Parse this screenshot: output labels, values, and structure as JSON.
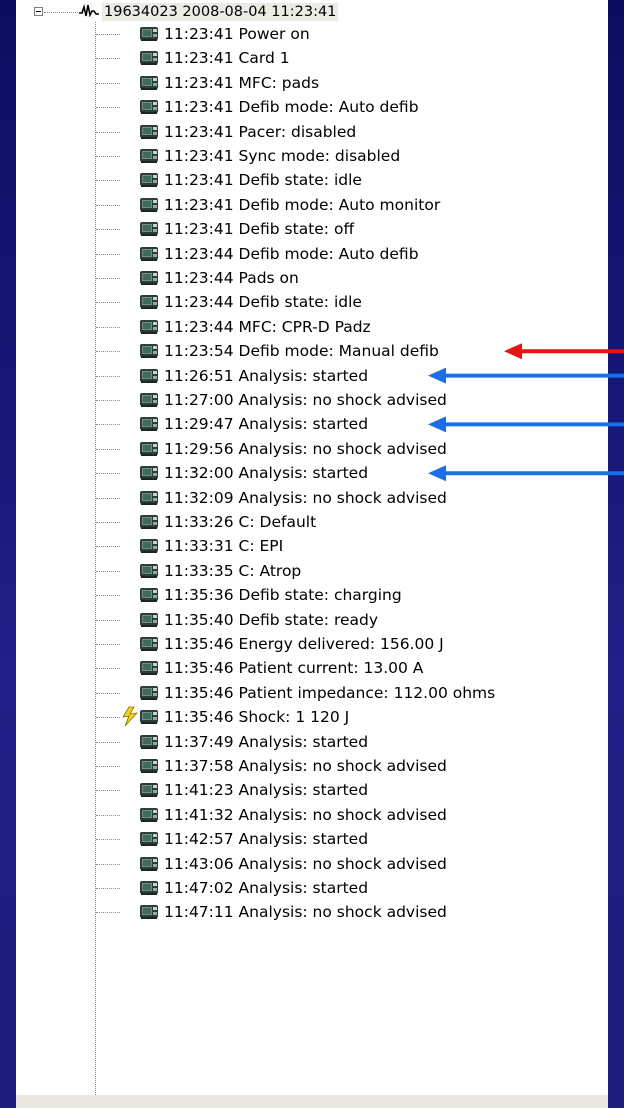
{
  "tree": {
    "root": {
      "label": "19634023 2008-08-04 11:23:41",
      "icon": "ecg-waveform-icon",
      "expander": "collapse"
    },
    "events": [
      {
        "label": "11:23:41 Power on",
        "icon": "device-monitor-icon"
      },
      {
        "label": "11:23:41 Card 1",
        "icon": "device-monitor-icon"
      },
      {
        "label": "11:23:41 MFC: pads",
        "icon": "device-monitor-icon"
      },
      {
        "label": "11:23:41 Defib mode: Auto defib",
        "icon": "device-monitor-icon"
      },
      {
        "label": "11:23:41 Pacer: disabled",
        "icon": "device-monitor-icon"
      },
      {
        "label": "11:23:41 Sync mode: disabled",
        "icon": "device-monitor-icon"
      },
      {
        "label": "11:23:41 Defib state: idle",
        "icon": "device-monitor-icon"
      },
      {
        "label": "11:23:41 Defib mode: Auto monitor",
        "icon": "device-monitor-icon"
      },
      {
        "label": "11:23:41 Defib state: off",
        "icon": "device-monitor-icon"
      },
      {
        "label": "11:23:44 Defib mode: Auto defib",
        "icon": "device-monitor-icon"
      },
      {
        "label": "11:23:44 Pads on",
        "icon": "device-monitor-icon"
      },
      {
        "label": "11:23:44 Defib state: idle",
        "icon": "device-monitor-icon"
      },
      {
        "label": "11:23:44 MFC: CPR-D Padz",
        "icon": "device-monitor-icon"
      },
      {
        "label": "11:23:54 Defib mode: Manual defib",
        "icon": "device-monitor-icon"
      },
      {
        "label": "11:26:51 Analysis: started",
        "icon": "device-monitor-icon"
      },
      {
        "label": "11:27:00 Analysis: no shock advised",
        "icon": "device-monitor-icon"
      },
      {
        "label": "11:29:47 Analysis: started",
        "icon": "device-monitor-icon"
      },
      {
        "label": "11:29:56 Analysis: no shock advised",
        "icon": "device-monitor-icon"
      },
      {
        "label": "11:32:00 Analysis: started",
        "icon": "device-monitor-icon"
      },
      {
        "label": "11:32:09 Analysis: no shock advised",
        "icon": "device-monitor-icon"
      },
      {
        "label": "11:33:26 C: Default",
        "icon": "device-monitor-icon"
      },
      {
        "label": "11:33:31 C: EPI",
        "icon": "device-monitor-icon"
      },
      {
        "label": "11:33:35 C: Atrop",
        "icon": "device-monitor-icon"
      },
      {
        "label": "11:35:36 Defib state: charging",
        "icon": "device-monitor-icon"
      },
      {
        "label": "11:35:40 Defib state: ready",
        "icon": "device-monitor-icon"
      },
      {
        "label": "11:35:46 Energy delivered: 156.00 J",
        "icon": "device-monitor-icon"
      },
      {
        "label": "11:35:46 Patient current: 13.00 A",
        "icon": "device-monitor-icon"
      },
      {
        "label": "11:35:46 Patient impedance: 112.00 ohms",
        "icon": "device-monitor-icon"
      },
      {
        "label": "11:35:46 Shock: 1 120 J",
        "icon": "device-monitor-icon",
        "shock": true
      },
      {
        "label": "11:37:49 Analysis: started",
        "icon": "device-monitor-icon"
      },
      {
        "label": "11:37:58 Analysis: no shock advised",
        "icon": "device-monitor-icon"
      },
      {
        "label": "11:41:23 Analysis: started",
        "icon": "device-monitor-icon"
      },
      {
        "label": "11:41:32 Analysis: no shock advised",
        "icon": "device-monitor-icon"
      },
      {
        "label": "11:42:57 Analysis: started",
        "icon": "device-monitor-icon"
      },
      {
        "label": "11:43:06 Analysis: no shock advised",
        "icon": "device-monitor-icon"
      },
      {
        "label": "11:47:02 Analysis: started",
        "icon": "device-monitor-icon"
      },
      {
        "label": "11:47:11 Analysis: no shock advised",
        "icon": "device-monitor-icon"
      }
    ]
  },
  "annotations": {
    "arrows": [
      {
        "row": 13,
        "color": "#ee1111",
        "icon": "red-arrow-icon"
      },
      {
        "row": 14,
        "color": "#1a6fe8",
        "icon": "blue-arrow-icon"
      },
      {
        "row": 16,
        "color": "#1a6fe8",
        "icon": "blue-arrow-icon"
      },
      {
        "row": 18,
        "color": "#1a6fe8",
        "icon": "blue-arrow-icon"
      }
    ]
  },
  "colors": {
    "background": "#1c1c7a",
    "panel": "#ffffff",
    "root_highlight": "#ecebe4"
  }
}
